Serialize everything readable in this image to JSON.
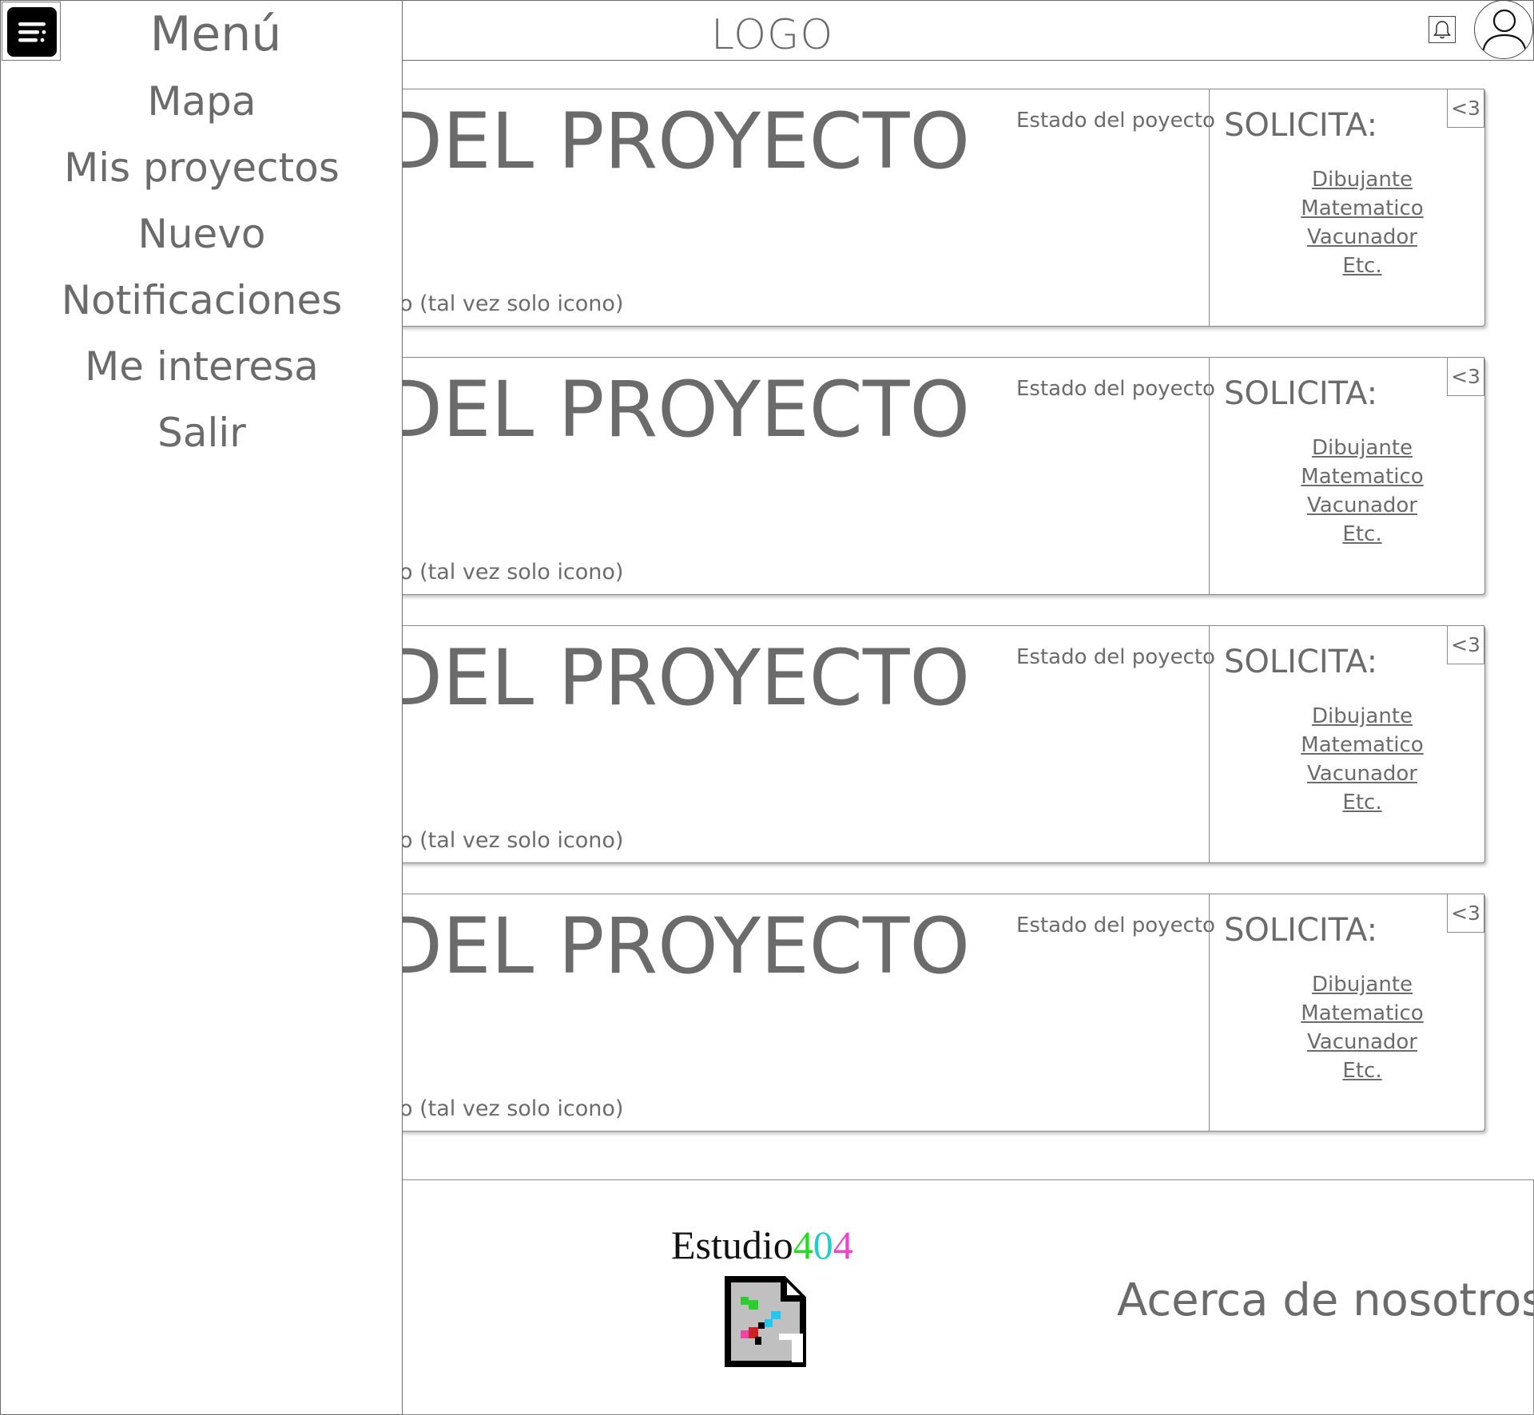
{
  "header": {
    "logo": "LOGO",
    "bell_icon": "bell-icon",
    "avatar_icon": "user-avatar-icon"
  },
  "cards": [
    {
      "title": "DEL PROYECTO",
      "subtitle": "o (tal vez solo icono)",
      "state": "Estado del poyecto",
      "solicita": "SOLICITA:",
      "roles": [
        "Dibujante",
        "Matematico",
        "Vacunador",
        "Etc."
      ],
      "like": "<3"
    },
    {
      "title": "DEL PROYECTO",
      "subtitle": "o (tal vez solo icono)",
      "state": "Estado del poyecto",
      "solicita": "SOLICITA:",
      "roles": [
        "Dibujante",
        "Matematico",
        "Vacunador",
        "Etc."
      ],
      "like": "<3"
    },
    {
      "title": "DEL PROYECTO",
      "subtitle": "o (tal vez solo icono)",
      "state": "Estado del poyecto",
      "solicita": "SOLICITA:",
      "roles": [
        "Dibujante",
        "Matematico",
        "Vacunador",
        "Etc."
      ],
      "like": "<3"
    },
    {
      "title": "DEL PROYECTO",
      "subtitle": "o (tal vez solo icono)",
      "state": "Estado del poyecto",
      "solicita": "SOLICITA:",
      "roles": [
        "Dibujante",
        "Matematico",
        "Vacunador",
        "Etc."
      ],
      "like": "<3"
    }
  ],
  "footer": {
    "brand_text": "Estudio",
    "brand_4a": "4",
    "brand_0": "0",
    "brand_4b": "4",
    "brand_colors": [
      "#22dd22",
      "#22cccc",
      "#ee44cc"
    ],
    "about": "Acerca de nosotros",
    "image_icon": "broken-image-icon"
  },
  "sidebar": {
    "menu_icon": "menu-icon",
    "title": "Menú",
    "items": [
      "Mapa",
      "Mis proyectos",
      "Nuevo",
      "Notificaciones",
      "Me interesa",
      "Salir"
    ]
  }
}
